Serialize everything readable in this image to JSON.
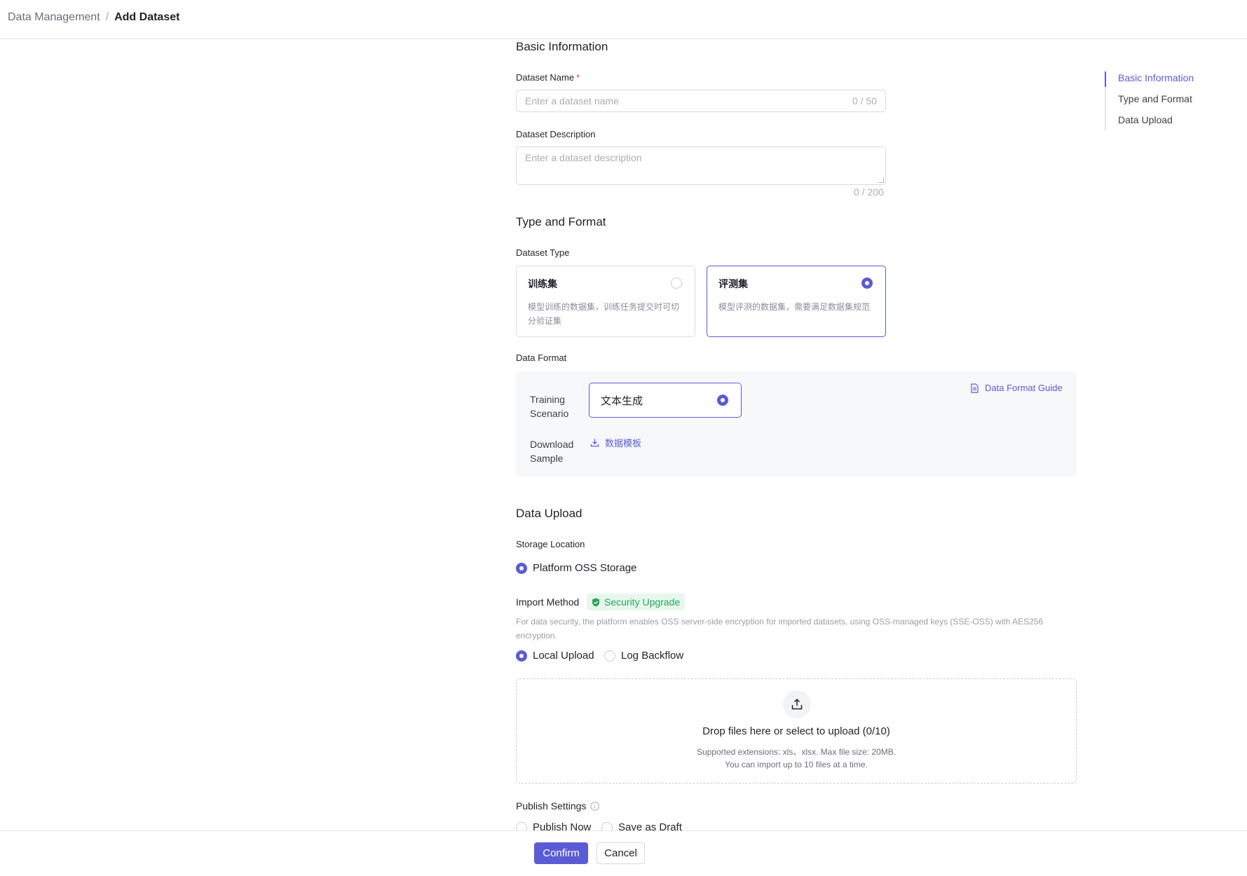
{
  "breadcrumb": {
    "parent": "Data Management",
    "separator": "/",
    "current": "Add Dataset"
  },
  "basic": {
    "title": "Basic Information",
    "name_label": "Dataset Name",
    "required_mark": "*",
    "name_placeholder": "Enter a dataset name",
    "name_count": "0 / 50",
    "desc_label": "Dataset Description",
    "desc_placeholder": "Enter a dataset description",
    "desc_count": "0 / 200"
  },
  "type_format": {
    "title": "Type and Format",
    "type_label": "Dataset Type",
    "types": [
      {
        "name": "训练集",
        "desc": "模型训练的数据集，训练任务提交时可切分验证集",
        "selected": false
      },
      {
        "name": "评测集",
        "desc": "模型评测的数据集，需要满足数据集规范",
        "selected": true
      }
    ],
    "format_label": "Data Format",
    "scenario_label": "Training Scenario",
    "scenario_value": "文本生成",
    "download_label": "Download Sample",
    "template_link": "数据模板",
    "guide_link": "Data Format Guide"
  },
  "upload": {
    "title": "Data Upload",
    "storage_label": "Storage Location",
    "storage_option": "Platform OSS Storage",
    "import_label": "Import Method",
    "badge": "Security Upgrade",
    "note": "For data security, the platform enables OSS server-side encryption for imported datasets, using OSS-managed keys (SSE-OSS) with AES256 encryption.",
    "methods": [
      "Local Upload",
      "Log Backflow"
    ],
    "dropzone_title": "Drop files here or select to upload (0/10)",
    "dropzone_line1": "Supported extensions: xls、xlsx. Max file size: 20MB.",
    "dropzone_line2": "You can import up to 10 files at a time.",
    "publish_label": "Publish Settings",
    "publish_options": [
      "Publish Now",
      "Save as Draft"
    ]
  },
  "toc": {
    "items": [
      "Basic Information",
      "Type and Format",
      "Data Upload"
    ],
    "active": 0
  },
  "footer": {
    "confirm": "Confirm",
    "cancel": "Cancel"
  },
  "colors": {
    "accent": "#5b5bd6",
    "success": "#23a55a",
    "required": "#f53f3f"
  }
}
